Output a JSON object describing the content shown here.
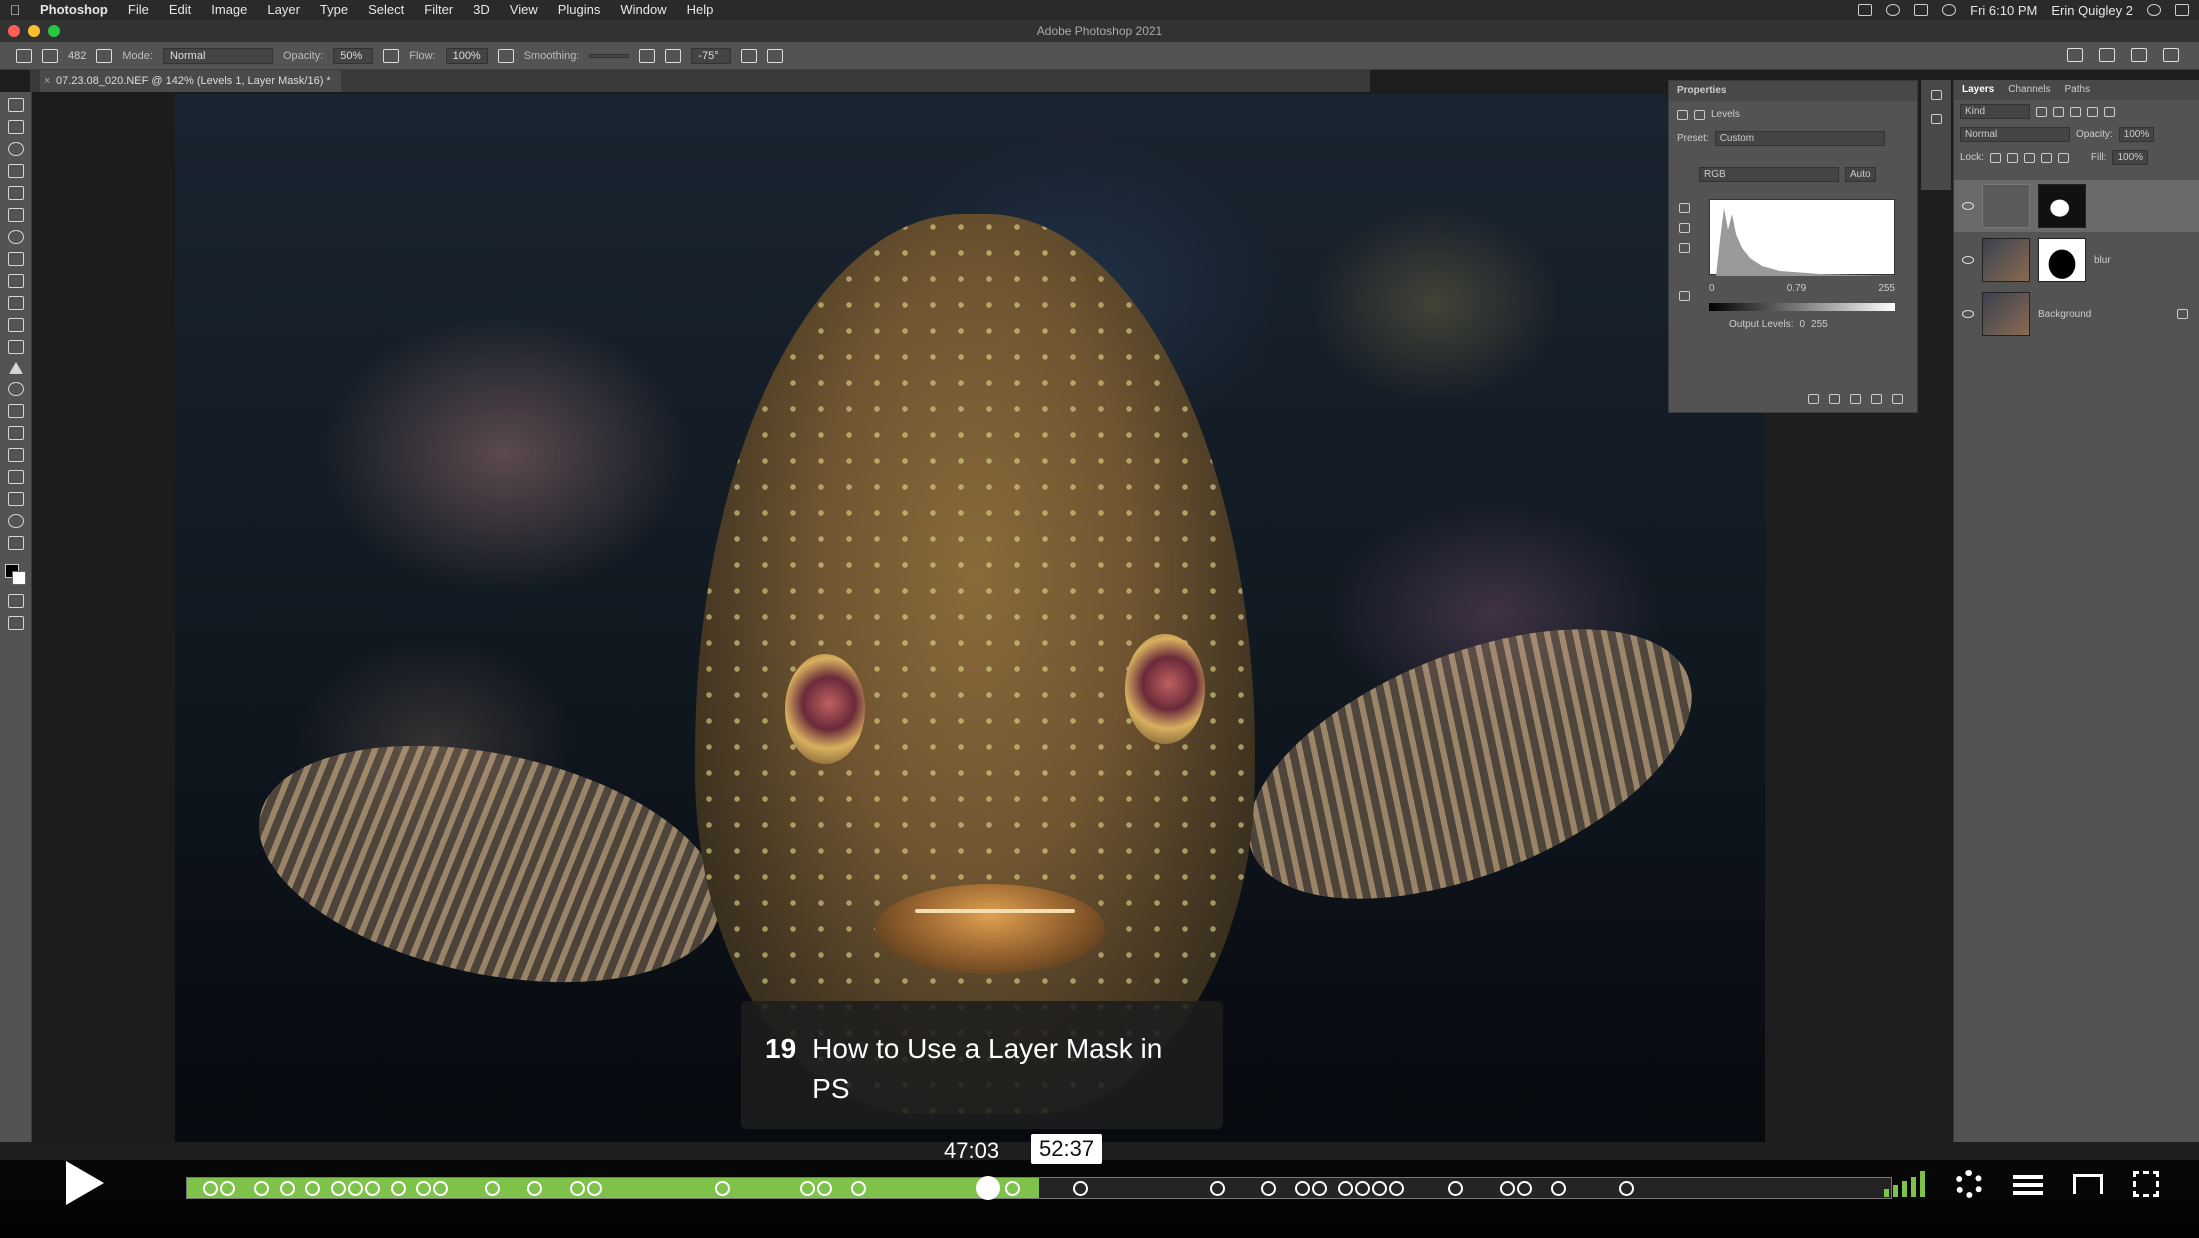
{
  "menubar": {
    "app": "Photoshop",
    "items": [
      "File",
      "Edit",
      "Image",
      "Layer",
      "Type",
      "Select",
      "Filter",
      "3D",
      "View",
      "Plugins",
      "Window",
      "Help"
    ],
    "clock": "Fri 6:10 PM",
    "user": "Erin Quigley 2"
  },
  "window": {
    "title": "Adobe Photoshop 2021"
  },
  "options": {
    "mode_label": "Mode:",
    "mode_value": "Normal",
    "opacity_label": "Opacity:",
    "opacity_value": "50%",
    "flow_label": "Flow:",
    "flow_value": "100%",
    "smoothing_label": "Smoothing:",
    "brush_size": "482",
    "angle_value": "-75°"
  },
  "document": {
    "tab_title": "07.23.08_020.NEF @ 142% (Levels 1, Layer Mask/16) *"
  },
  "properties": {
    "title": "Properties",
    "adjustment": "Levels",
    "preset_label": "Preset:",
    "preset_value": "Custom",
    "channel": "RGB",
    "auto_label": "Auto",
    "input_black": "0",
    "input_gamma": "0.79",
    "input_white": "255",
    "output_label": "Output Levels:",
    "output_black": "0",
    "output_white": "255"
  },
  "layers": {
    "tabs": [
      "Layers",
      "Channels",
      "Paths"
    ],
    "kind_label": "Kind",
    "blend_mode": "Normal",
    "opacity_label": "Opacity:",
    "opacity_value": "100%",
    "lock_label": "Lock:",
    "fill_label": "Fill:",
    "fill_value": "100%",
    "items": [
      {
        "name": ""
      },
      {
        "name": "blur"
      },
      {
        "name": "Background"
      }
    ]
  },
  "video": {
    "chapter_number": "19",
    "chapter_title": "How to Use a Layer Mask in PS",
    "current_time": "47:03",
    "total_time": "52:37",
    "progress_fraction": 0.5,
    "played_fraction": 0.47,
    "accent_color": "#7fc24a"
  }
}
